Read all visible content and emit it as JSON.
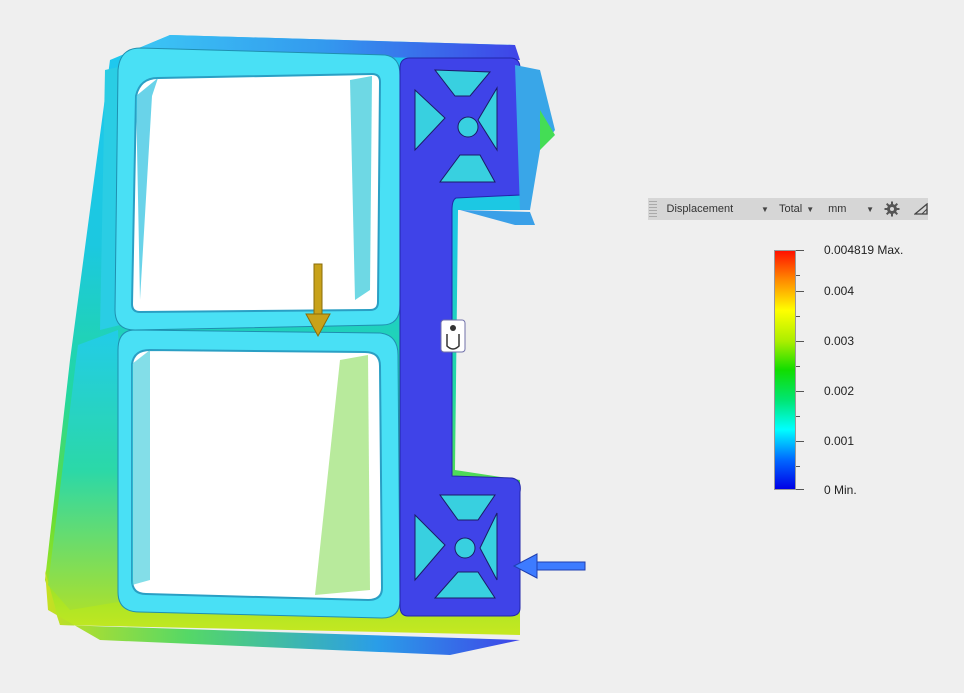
{
  "toolbar": {
    "result_type": "Displacement",
    "component": "Total",
    "unit": "mm",
    "settings_icon": "gear-icon",
    "probe_icon": "triangle-icon"
  },
  "legend": {
    "labels": [
      "0.004819 Max.",
      "0.004",
      "0.003",
      "0.002",
      "0.001",
      "0 Min."
    ],
    "gradient_colors": [
      "#0000e6",
      "#0066ff",
      "#00ffff",
      "#00e676",
      "#11dd00",
      "#aaee00",
      "#ffff00",
      "#ff8800",
      "#ff1100"
    ]
  },
  "model": {
    "load_arrow_color": "#c8a21a",
    "fixed_constraint_arrow_color": "#3d7bff",
    "fixed_part_color": "#3f43e8",
    "frame_color": "#49e0f5"
  }
}
